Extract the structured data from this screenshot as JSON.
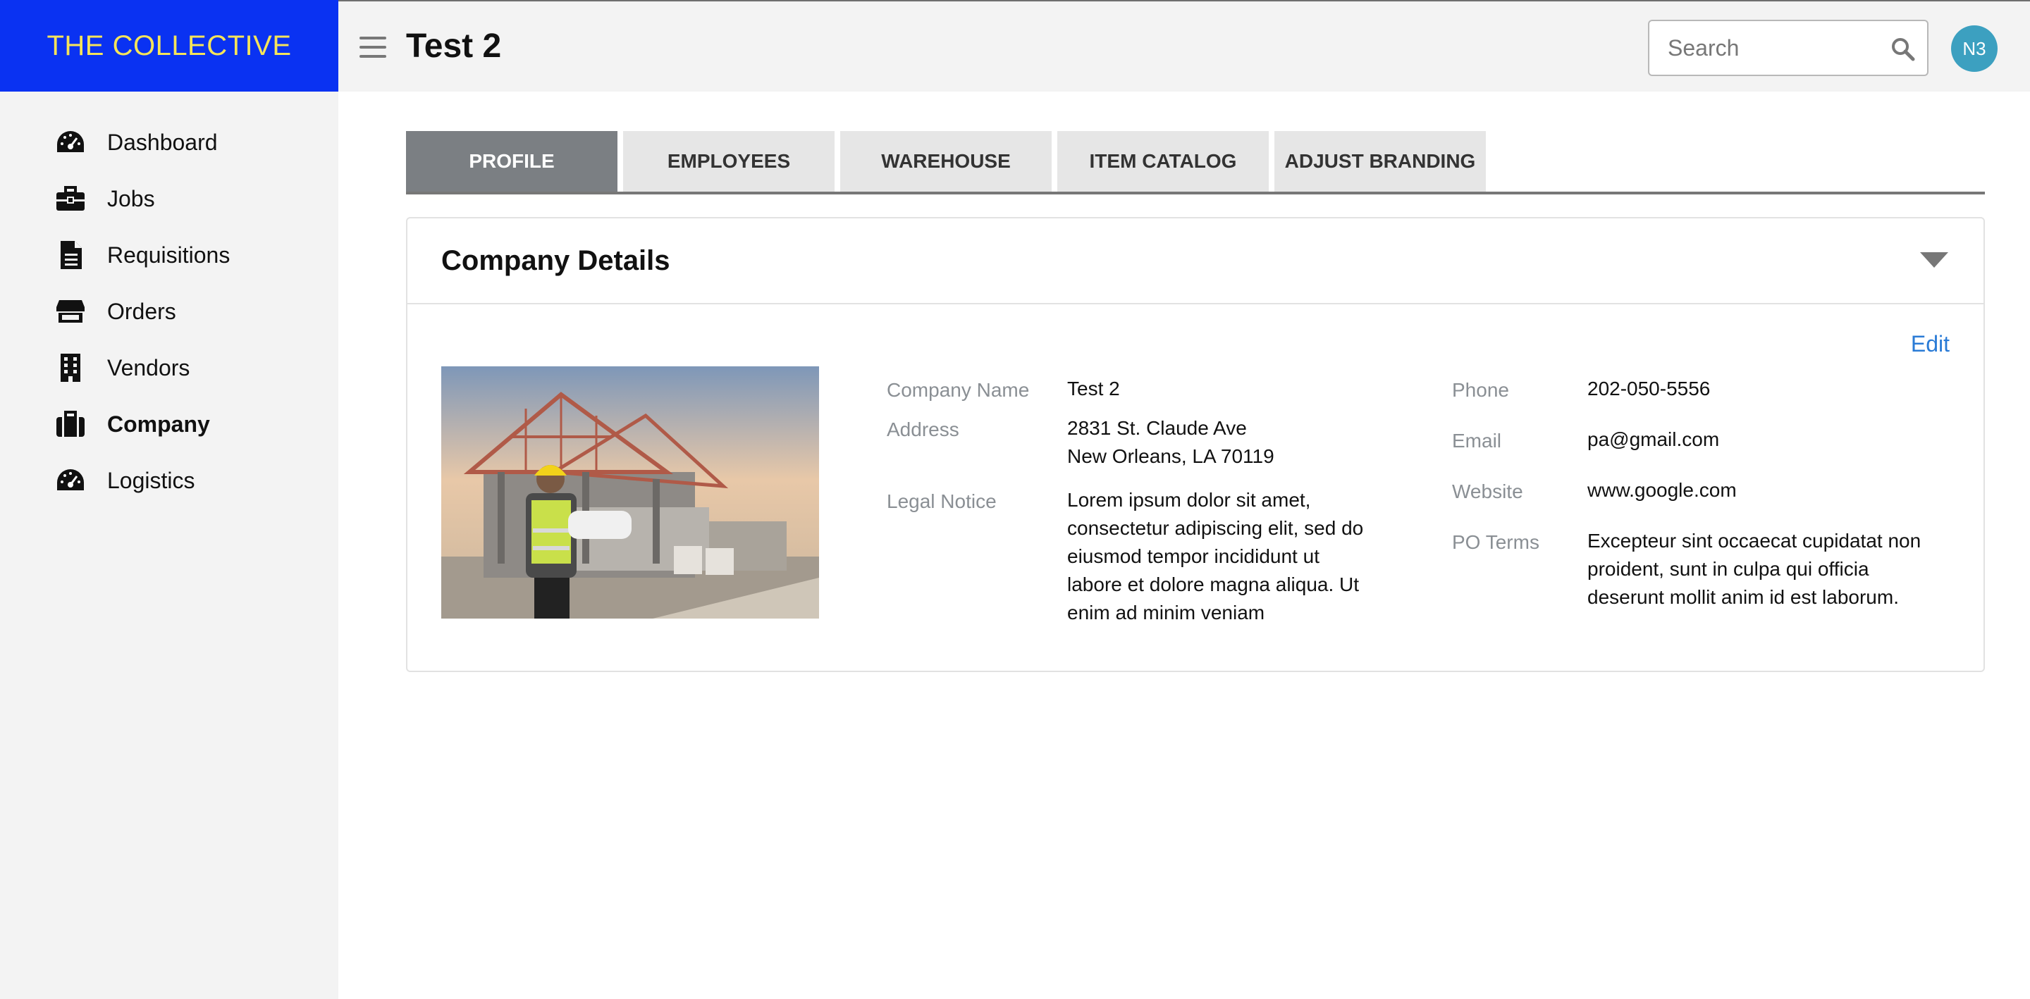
{
  "app": {
    "brand": "THE COLLECTIVE",
    "brand_color": "#0a32f2",
    "brand_text_color": "#f5e45a"
  },
  "sidebar": {
    "items": [
      {
        "label": "Dashboard",
        "icon": "speedometer-icon"
      },
      {
        "label": "Jobs",
        "icon": "briefcase-icon"
      },
      {
        "label": "Requisitions",
        "icon": "document-icon"
      },
      {
        "label": "Orders",
        "icon": "store-icon"
      },
      {
        "label": "Vendors",
        "icon": "building-icon"
      },
      {
        "label": "Company",
        "icon": "suitcase-icon",
        "active": true
      },
      {
        "label": "Logistics",
        "icon": "speedometer-icon"
      }
    ]
  },
  "header": {
    "title": "Test 2",
    "search_placeholder": "Search",
    "avatar_initials": "N3",
    "avatar_color": "#3ca0c0"
  },
  "tabs": [
    {
      "label": "PROFILE",
      "active": true
    },
    {
      "label": "EMPLOYEES"
    },
    {
      "label": "WAREHOUSE"
    },
    {
      "label": "ITEM CATALOG"
    },
    {
      "label": "ADJUST BRANDING"
    }
  ],
  "company_details": {
    "title": "Company Details",
    "edit_label": "Edit",
    "left_fields": [
      {
        "label": "Company Name",
        "lines": [
          "Test 2"
        ]
      },
      {
        "label": "Address",
        "lines": [
          "2831 St. Claude Ave",
          "New Orleans, LA 70119"
        ]
      },
      {
        "label": "Legal Notice",
        "lines": [
          "Lorem ipsum dolor sit amet,",
          "consectetur adipiscing elit, sed do",
          "eiusmod tempor incididunt ut",
          "labore et dolore magna aliqua. Ut",
          "enim ad minim veniam"
        ]
      }
    ],
    "right_fields": [
      {
        "label": "Phone",
        "lines": [
          "202-050-5556"
        ]
      },
      {
        "label": "Email",
        "lines": [
          "pa@gmail.com"
        ]
      },
      {
        "label": "Website",
        "lines": [
          "www.google.com"
        ]
      },
      {
        "label": "PO Terms",
        "lines": [
          "Excepteur sint occaecat cupidatat non",
          "proident, sunt in culpa qui officia",
          "deserunt mollit anim id est laborum."
        ]
      }
    ]
  }
}
